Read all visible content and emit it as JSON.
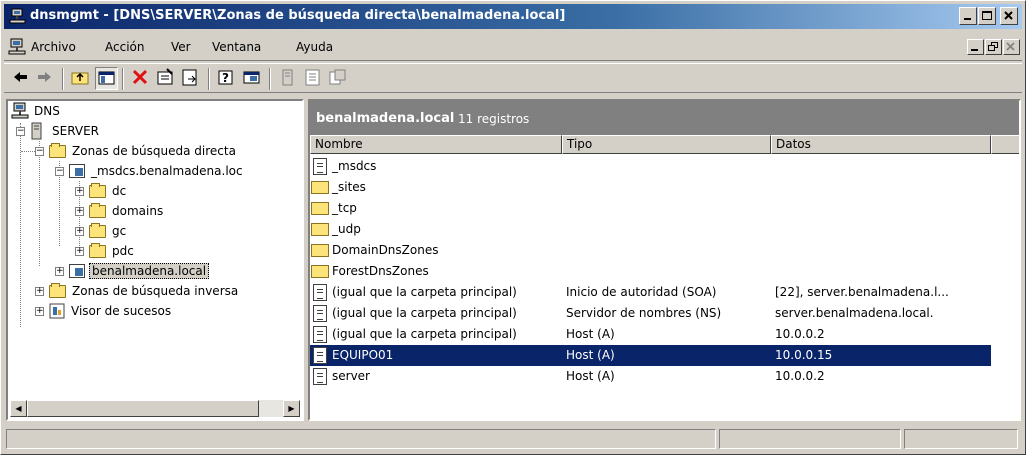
{
  "window": {
    "title": "dnsmgmt - [DNS\\SERVER\\Zonas de búsqueda directa\\benalmadena.local]",
    "titlebar_color": "#0a246a"
  },
  "menu": {
    "items": [
      "Archivo",
      "Acción",
      "Ver",
      "Ventana",
      "Ayuda"
    ]
  },
  "toolbar": {
    "icons": [
      "back-arrow-icon",
      "forward-arrow-icon",
      "up-folder-icon",
      "show-tree-icon",
      "delete-icon",
      "properties-icon",
      "export-icon",
      "help-icon",
      "console-icon",
      "server-icon",
      "zone-icon",
      "record-icon"
    ]
  },
  "tree": {
    "root": "DNS",
    "server": "SERVER",
    "forward_zones": "Zonas de búsqueda directa",
    "msdcs": "_msdcs.benalmadena.loc",
    "dc": "dc",
    "domains": "domains",
    "gc": "gc",
    "pdc": "pdc",
    "benalmadena": "benalmadena.local",
    "reverse_zones": "Zonas de búsqueda inversa",
    "event_viewer": "Visor de sucesos"
  },
  "list": {
    "title": "benalmadena.local",
    "count": "11 registros",
    "columns": [
      "Nombre",
      "Tipo",
      "Datos"
    ],
    "rows": [
      {
        "name": "_msdcs",
        "type": "",
        "data": "",
        "icon": "zone-icon"
      },
      {
        "name": "_sites",
        "type": "",
        "data": "",
        "icon": "folder-icon"
      },
      {
        "name": "_tcp",
        "type": "",
        "data": "",
        "icon": "folder-icon"
      },
      {
        "name": "_udp",
        "type": "",
        "data": "",
        "icon": "folder-icon"
      },
      {
        "name": "DomainDnsZones",
        "type": "",
        "data": "",
        "icon": "folder-icon"
      },
      {
        "name": "ForestDnsZones",
        "type": "",
        "data": "",
        "icon": "folder-icon"
      },
      {
        "name": "(igual que la carpeta principal)",
        "type": "Inicio de autoridad (SOA)",
        "data": "[22], server.benalmadena.l...",
        "icon": "record-icon"
      },
      {
        "name": "(igual que la carpeta principal)",
        "type": "Servidor de nombres (NS)",
        "data": "server.benalmadena.local.",
        "icon": "record-icon"
      },
      {
        "name": "(igual que la carpeta principal)",
        "type": "Host (A)",
        "data": "10.0.0.2",
        "icon": "record-icon"
      },
      {
        "name": "EQUIPO01",
        "type": "Host (A)",
        "data": "10.0.0.15",
        "icon": "record-icon"
      },
      {
        "name": "server",
        "type": "Host (A)",
        "data": "10.0.0.2",
        "icon": "record-icon"
      }
    ],
    "selected_color": "#0a246a"
  }
}
